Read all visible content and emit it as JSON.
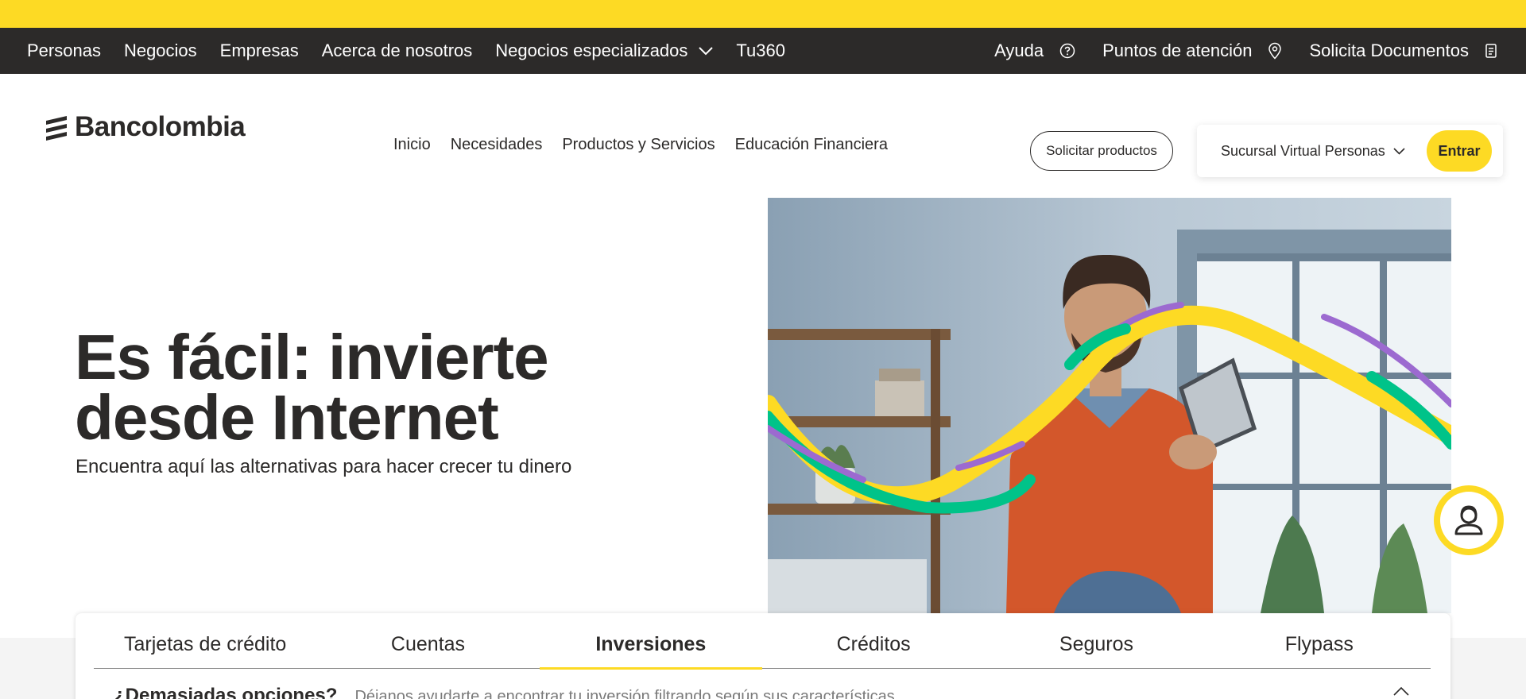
{
  "utility_bar": {
    "left_links": [
      "Personas",
      "Negocios",
      "Empresas",
      "Acerca de nosotros"
    ],
    "specialized": "Negocios especializados",
    "tu360": "Tu360",
    "help": "Ayuda",
    "points": "Puntos de atención",
    "documents": "Solicita Documentos"
  },
  "header": {
    "logo_text": "Bancolombia",
    "nav": [
      "Inicio",
      "Necesidades",
      "Productos y Servicios",
      "Educación Financiera"
    ],
    "solicitar": "Solicitar productos",
    "sucursal": "Sucursal Virtual Personas",
    "entrar": "Entrar"
  },
  "hero": {
    "title_line1": "Es fácil: invierte",
    "title_line2": "desde Internet",
    "subtitle": "Encuentra aquí las alternativas para hacer crecer tu dinero"
  },
  "tabs": {
    "items": [
      "Tarjetas de crédito",
      "Cuentas",
      "Inversiones",
      "Créditos",
      "Seguros",
      "Flypass"
    ],
    "active": "Inversiones"
  },
  "filter": {
    "title": "¿Demasiadas opciones?",
    "description": "Déjanos ayudarte a encontrar tu inversión filtrando según sus características"
  },
  "icons": {
    "specialized": "chevron-down-icon",
    "help": "help-circle-icon",
    "points": "location-pin-icon",
    "documents": "document-icon",
    "sucursal": "chevron-down-icon",
    "chat": "chat-agent-icon",
    "filter": "chevron-up-icon"
  },
  "colors": {
    "brand_yellow": "#fdda24",
    "dark": "#2c2a29",
    "accent_green": "#00c389",
    "accent_purple": "#9c6ad0"
  }
}
